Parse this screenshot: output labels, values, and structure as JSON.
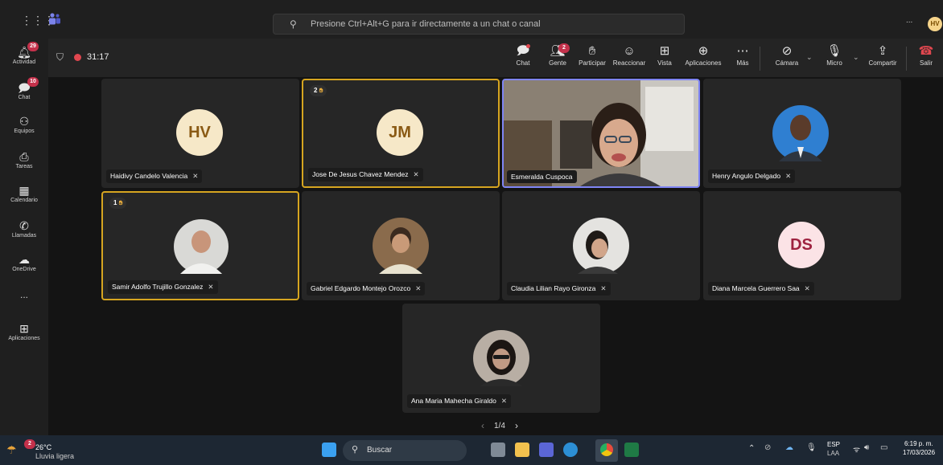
{
  "topbar": {
    "search_placeholder": "Presione Ctrl+Alt+G para ir directamente a un chat o canal",
    "more": "...",
    "avatar_initials": "HV"
  },
  "rail": [
    {
      "label": "Actividad",
      "badge": "29"
    },
    {
      "label": "Chat",
      "badge": "10"
    },
    {
      "label": "Equipos"
    },
    {
      "label": "Tareas"
    },
    {
      "label": "Calendario"
    },
    {
      "label": "Llamadas"
    },
    {
      "label": "OneDrive"
    },
    {
      "label": "..."
    },
    {
      "label": "Aplicaciones"
    }
  ],
  "meeting": {
    "timer": "31:17",
    "toolbar": {
      "chat": "Chat",
      "people": "Gente",
      "people_badge": "2",
      "participate": "Participar",
      "react": "Reaccionar",
      "view": "Vista",
      "apps": "Aplicaciones",
      "more": "Más",
      "camera": "Cámara",
      "mic": "Micro",
      "share": "Compartir",
      "leave": "Salir"
    },
    "participants": [
      {
        "name": "Haidivy Candelo Valencia",
        "initials": "HV",
        "avatar_bg": "#f6e8c8",
        "avatar_fg": "#8a5a14"
      },
      {
        "name": "Jose De Jesus Chavez Mendez",
        "initials": "JM",
        "avatar_bg": "#f6e8c8",
        "avatar_fg": "#8a5a14",
        "hand": "2"
      },
      {
        "name": "Esmeralda Cuspoca"
      },
      {
        "name": "Henry Angulo Delgado"
      },
      {
        "name": "Samir Adolfo Trujillo Gonzalez",
        "hand": "1"
      },
      {
        "name": "Gabriel Edgardo Montejo Orozco"
      },
      {
        "name": "Claudia Lilian Rayo Gironza"
      },
      {
        "name": "Diana Marcela Guerrero Saa",
        "initials": "DS",
        "avatar_bg": "#fbe3e6",
        "avatar_fg": "#9e2240"
      },
      {
        "name": "Ana Maria Mahecha Giraldo"
      }
    ],
    "pagination": "1/4"
  },
  "taskbar": {
    "weather_temp": "26°C",
    "weather_desc": "Lluvia ligera",
    "weather_badge": "2",
    "search": "Buscar",
    "lang": "ESP",
    "lang_sub": "LAA",
    "time": "6:19 p. m.",
    "date": "17/03/2026"
  }
}
